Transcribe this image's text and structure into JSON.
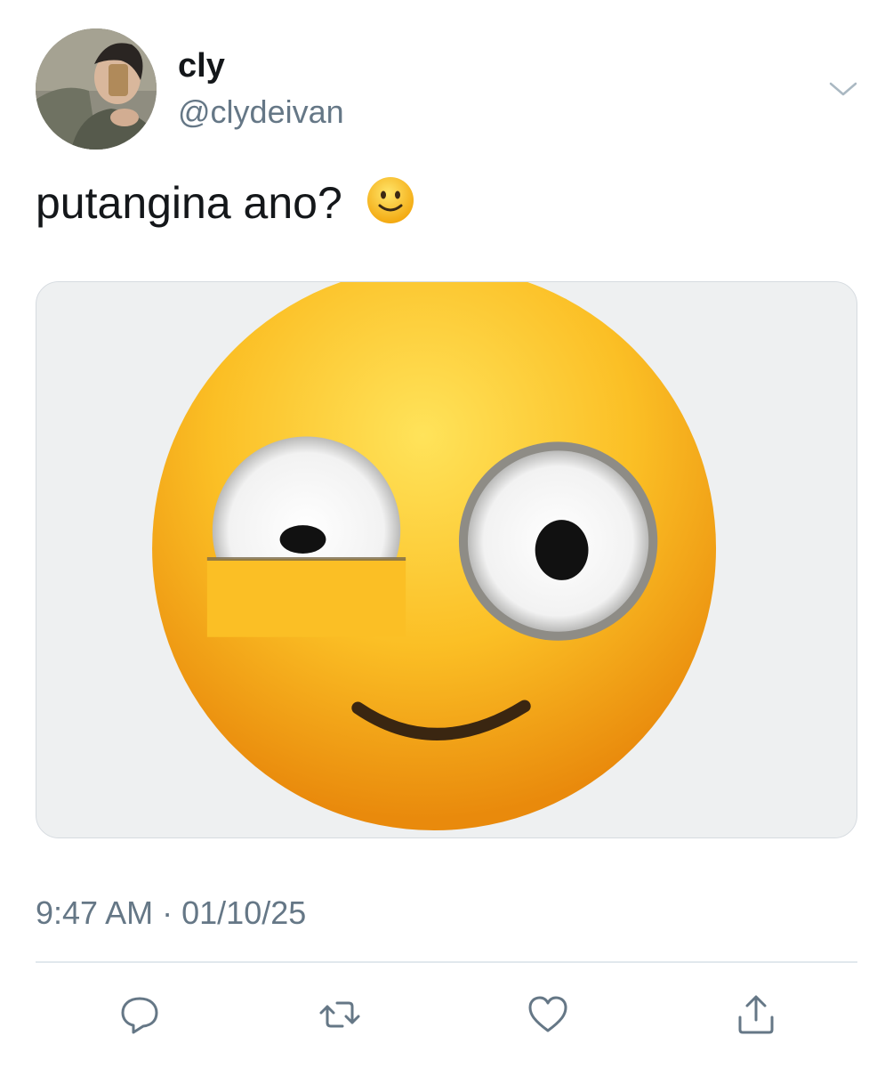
{
  "author": {
    "display_name": "cly",
    "handle": "@clydeivan",
    "avatar_icon": "profile-photo",
    "caret_icon": "chevron-down-icon"
  },
  "tweet": {
    "text": "putangina ano?",
    "inline_emoji": "slightly-smiling-face-emoji",
    "media_description_icon": "flushed-smirk-emoji-image"
  },
  "meta": {
    "time": "9:47 AM",
    "separator": "·",
    "date": "01/10/25"
  },
  "actions": {
    "reply_icon": "reply-icon",
    "retweet_icon": "retweet-icon",
    "like_icon": "heart-icon",
    "share_icon": "share-icon"
  },
  "colors": {
    "text_primary": "#14171a",
    "text_secondary": "#657786",
    "divider": "#e1e8ed",
    "emoji_yellow": "#f7b820"
  }
}
